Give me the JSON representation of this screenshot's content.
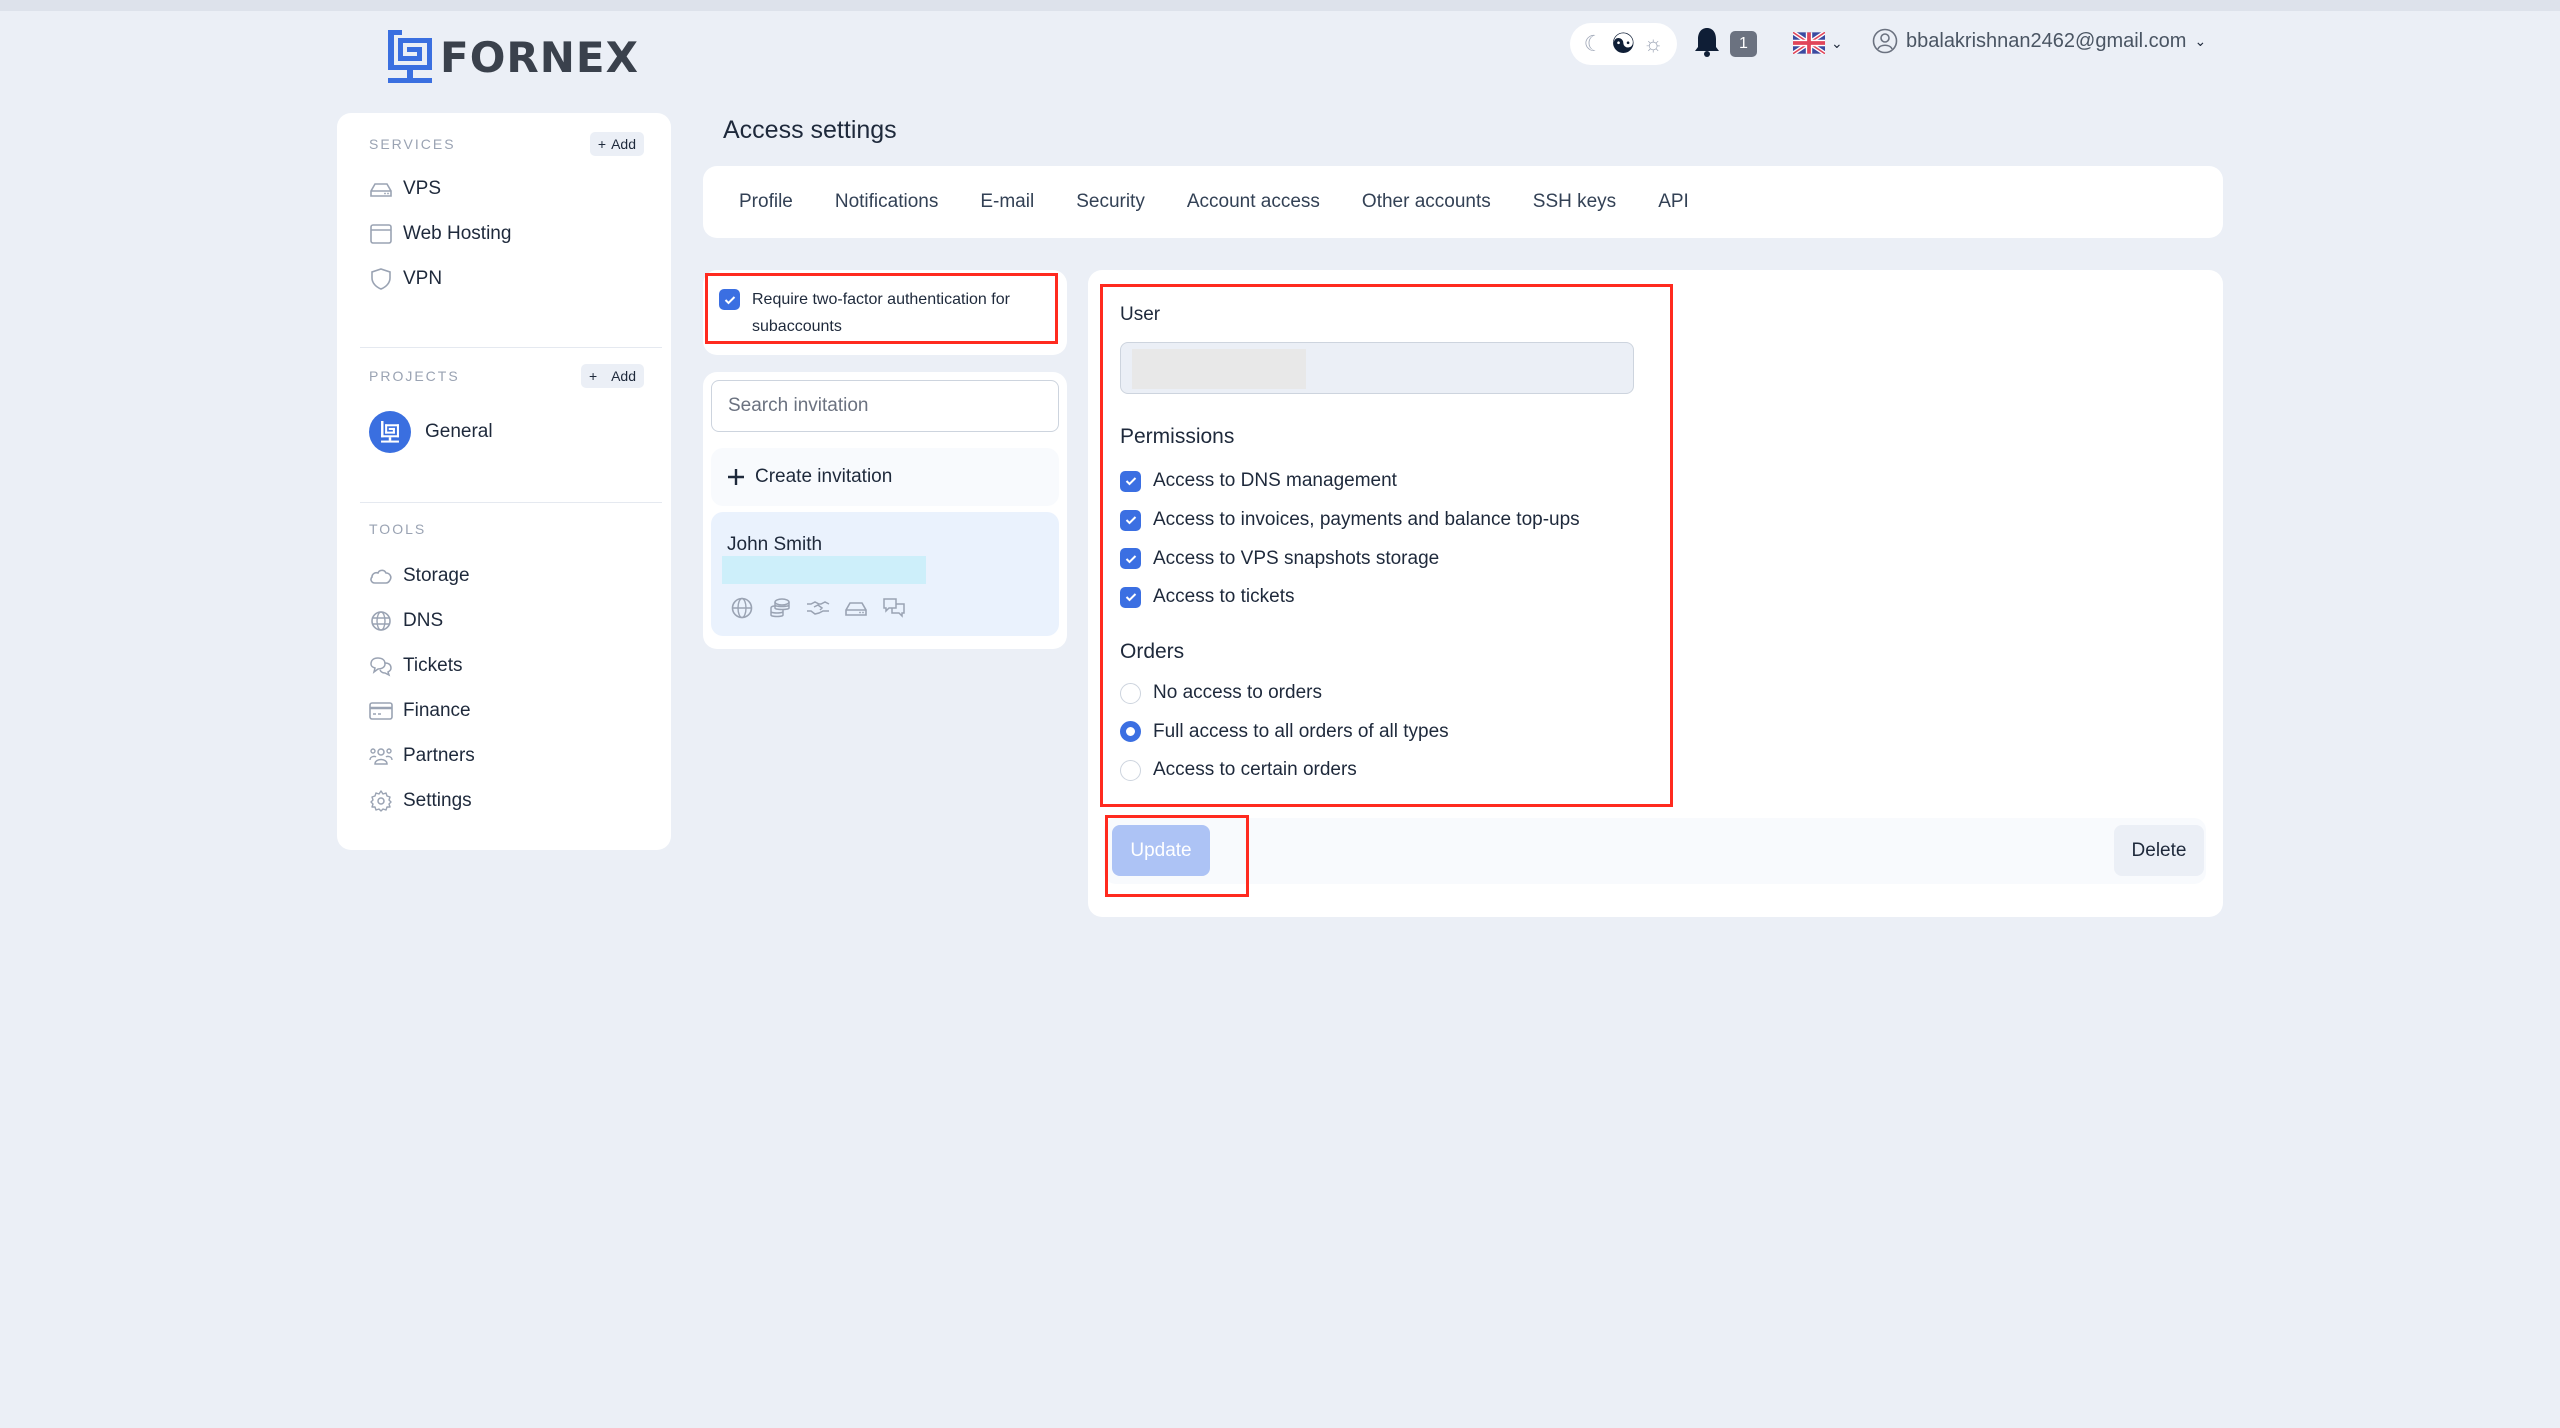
{
  "header": {
    "brand": "FORNEX",
    "theme_options": [
      "dark",
      "auto",
      "light"
    ],
    "theme_selected": "auto",
    "notification_count": "1",
    "language": "English (UK)",
    "user_email": "bbalakrishnan2462@gmail.com"
  },
  "sidebar": {
    "services": {
      "title": "SERVICES",
      "add_label": "Add",
      "items": [
        {
          "label": "VPS",
          "icon": "server-icon"
        },
        {
          "label": "Web Hosting",
          "icon": "browser-window-icon"
        },
        {
          "label": "VPN",
          "icon": "shield-icon"
        }
      ]
    },
    "projects": {
      "title": "PROJECTS",
      "add_label": "Add",
      "items": [
        {
          "label": "General",
          "icon": "fornex-logo-icon"
        }
      ]
    },
    "tools": {
      "title": "TOOLS",
      "items": [
        {
          "label": "Storage",
          "icon": "cloud-icon"
        },
        {
          "label": "DNS",
          "icon": "globe-icon"
        },
        {
          "label": "Tickets",
          "icon": "chat-bubbles-icon"
        },
        {
          "label": "Finance",
          "icon": "credit-card-icon"
        },
        {
          "label": "Partners",
          "icon": "users-icon"
        },
        {
          "label": "Settings",
          "icon": "gear-icon"
        }
      ]
    }
  },
  "page": {
    "title": "Access settings",
    "tabs": [
      "Profile",
      "Notifications",
      "E-mail",
      "Security",
      "Account access",
      "Other accounts",
      "SSH keys",
      "API"
    ]
  },
  "invitations": {
    "require_2fa_label": "Require two-factor authentication for subaccounts",
    "require_2fa_checked": true,
    "search_placeholder": "Search invitation",
    "search_value": "",
    "create_label": "Create invitation",
    "items": [
      {
        "name": "John Smith",
        "permission_icons": [
          "globe-icon",
          "coins-icon",
          "handshake-icon",
          "server-icon",
          "chat-bubbles-icon"
        ]
      }
    ]
  },
  "details": {
    "user_label": "User",
    "user_value": "",
    "permissions_title": "Permissions",
    "permissions": [
      {
        "label": "Access to DNS management",
        "checked": true
      },
      {
        "label": "Access to invoices, payments and balance top-ups",
        "checked": true
      },
      {
        "label": "Access to VPS snapshots storage",
        "checked": true
      },
      {
        "label": "Access to tickets",
        "checked": true
      }
    ],
    "orders_title": "Orders",
    "orders": [
      {
        "label": "No access to orders",
        "selected": false
      },
      {
        "label": "Full access to all orders of all types",
        "selected": true
      },
      {
        "label": "Access to certain orders",
        "selected": false
      }
    ],
    "update_label": "Update",
    "delete_label": "Delete"
  },
  "colors": {
    "accent": "#3b6fe2",
    "highlight_annotation": "#ff2a1f",
    "background": "#ebeff6"
  }
}
